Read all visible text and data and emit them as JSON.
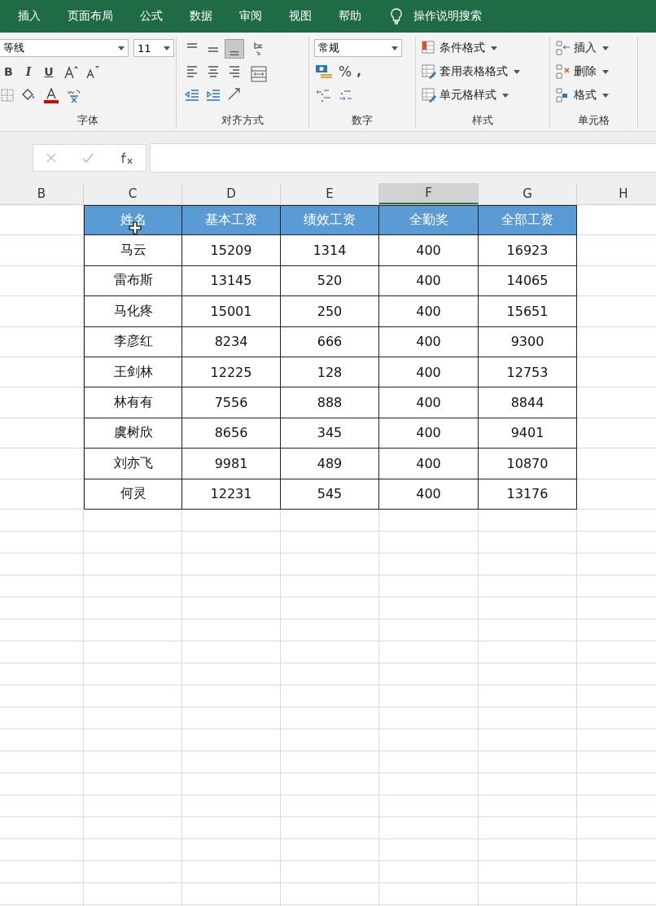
{
  "tabs": [
    {
      "label": "插入",
      "selected": false
    },
    {
      "label": "页面布局",
      "selected": false
    },
    {
      "label": "公式",
      "selected": false
    },
    {
      "label": "数据",
      "selected": false
    },
    {
      "label": "审阅",
      "selected": false
    },
    {
      "label": "视图",
      "selected": false
    },
    {
      "label": "帮助",
      "selected": false
    }
  ],
  "tell_me": {
    "label": "操作说明搜索"
  },
  "font_group": {
    "font_name": "等线",
    "font_size": "11",
    "format_buttons": [
      "B",
      "I",
      "U"
    ],
    "label": "字体"
  },
  "alignment_group": {
    "label": "对齐方式"
  },
  "number_group": {
    "format": "常规",
    "percent": "%",
    "comma": ",",
    "label": "数字"
  },
  "styles_group": {
    "buttons": [
      "条件格式",
      "套用表格格式",
      "单元格样式"
    ],
    "label": "样式"
  },
  "cells_group": {
    "buttons": [
      "插入",
      "删除",
      "格式"
    ],
    "label": "单元格"
  },
  "column_headers": [
    {
      "label": "B",
      "selected": false
    },
    {
      "label": "C",
      "selected": false
    },
    {
      "label": "D",
      "selected": false
    },
    {
      "label": "E",
      "selected": false
    },
    {
      "label": "F",
      "selected": true
    },
    {
      "label": "G",
      "selected": false
    },
    {
      "label": "H",
      "selected": false
    }
  ],
  "table": {
    "columns": [
      "姓名",
      "基本工资",
      "绩效工资",
      "全勤奖",
      "全部工资"
    ],
    "rows": [
      [
        "马云",
        "15209",
        "1314",
        "400",
        "16923"
      ],
      [
        "雷布斯",
        "13145",
        "520",
        "400",
        "14065"
      ],
      [
        "马化疼",
        "15001",
        "250",
        "400",
        "15651"
      ],
      [
        "李彦红",
        "8234",
        "666",
        "400",
        "9300"
      ],
      [
        "王剑林",
        "12225",
        "128",
        "400",
        "12753"
      ],
      [
        "林有有",
        "7556",
        "888",
        "400",
        "8844"
      ],
      [
        "虞树欣",
        "8656",
        "345",
        "400",
        "9401"
      ],
      [
        "刘亦飞",
        "9981",
        "489",
        "400",
        "10870"
      ],
      [
        "何灵",
        "12231",
        "545",
        "400",
        "13176"
      ]
    ]
  }
}
